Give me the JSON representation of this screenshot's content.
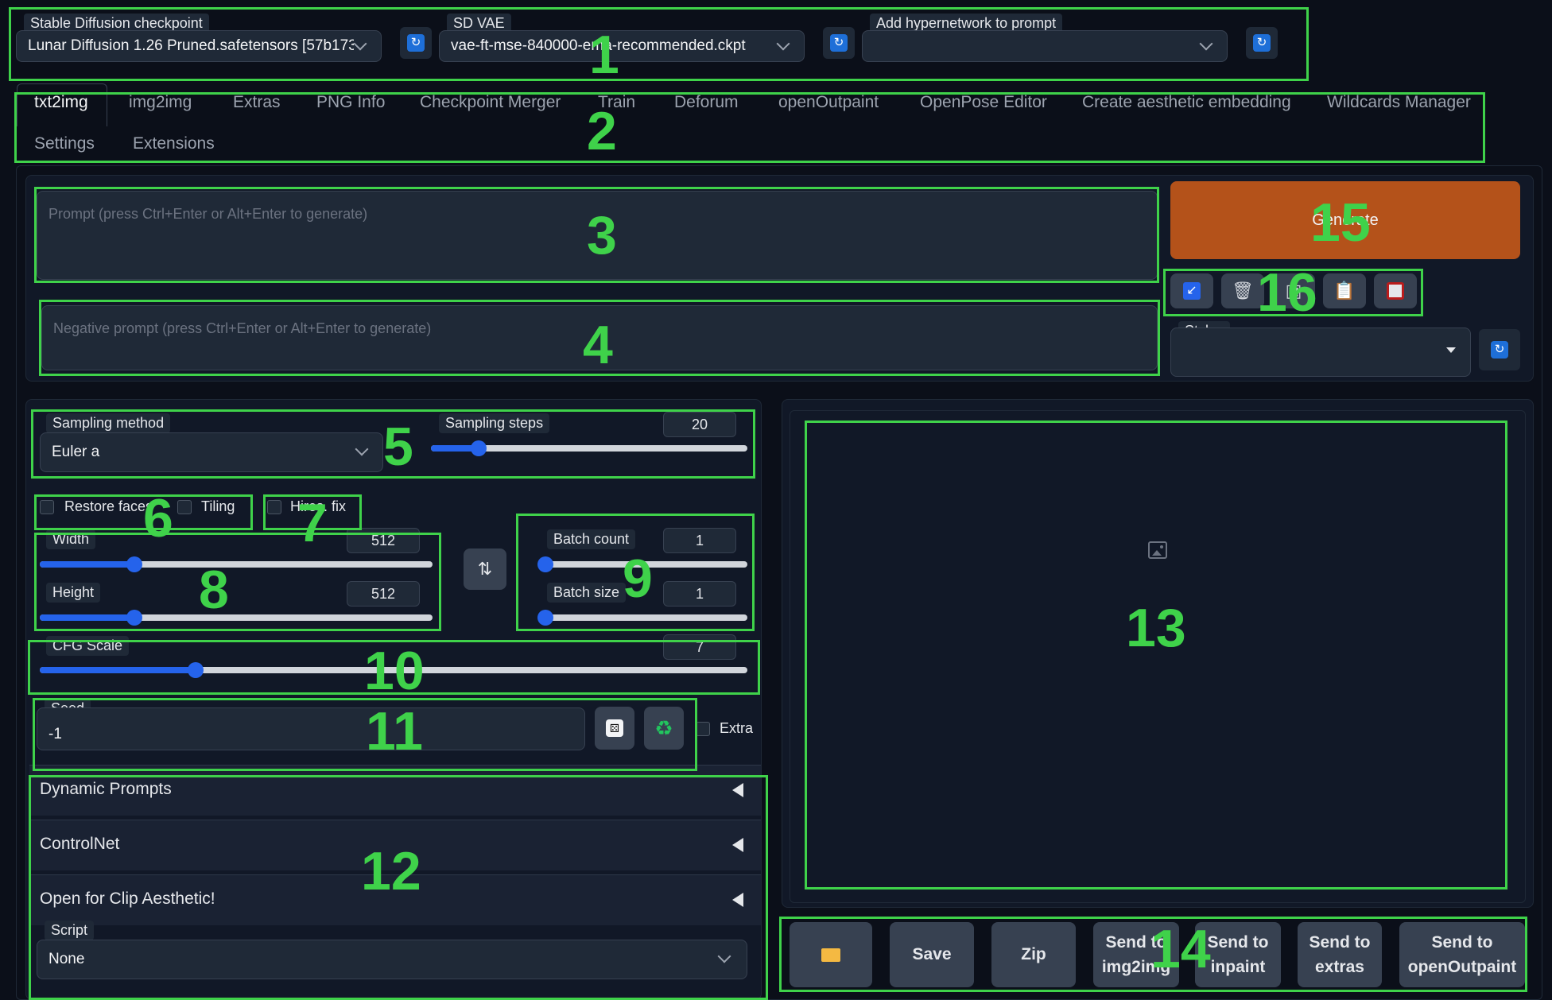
{
  "settings": {
    "checkpoint_label": "Stable Diffusion checkpoint",
    "checkpoint_value": "Lunar Diffusion 1.26 Pruned.safetensors [57b173",
    "vae_label": "SD VAE",
    "vae_value": "vae-ft-mse-840000-ema-recommended.ckpt",
    "hypernetwork_label": "Add hypernetwork to prompt",
    "hypernetwork_value": ""
  },
  "tabs": [
    "txt2img",
    "img2img",
    "Extras",
    "PNG Info",
    "Checkpoint Merger",
    "Train",
    "Deforum",
    "openOutpaint",
    "OpenPose Editor",
    "Create aesthetic embedding",
    "Wildcards Manager",
    "Settings",
    "Extensions"
  ],
  "prompt": {
    "placeholder": "Prompt (press Ctrl+Enter or Alt+Enter to generate)",
    "negative_placeholder": "Negative prompt (press Ctrl+Enter or Alt+Enter to generate)"
  },
  "generate": {
    "label": "Generate",
    "color": "#b4521a"
  },
  "styles": {
    "label": "Styles",
    "value": ""
  },
  "sampling": {
    "method_label": "Sampling method",
    "method_value": "Euler a",
    "steps_label": "Sampling steps",
    "steps_value": "20",
    "steps_fraction": 0.15
  },
  "options": {
    "restore_faces": "Restore faces",
    "tiling": "Tiling",
    "hires_fix": "Hires. fix"
  },
  "size": {
    "width_label": "Width",
    "width_value": "512",
    "height_label": "Height",
    "height_value": "512",
    "fraction": 0.24
  },
  "batch": {
    "count_label": "Batch count",
    "count_value": "1",
    "size_label": "Batch size",
    "size_value": "1"
  },
  "cfg": {
    "label": "CFG Scale",
    "value": "7",
    "fraction": 0.22
  },
  "seed": {
    "label": "Seed",
    "value": "-1",
    "extra_label": "Extra"
  },
  "accordions": [
    "Dynamic Prompts",
    "ControlNet",
    "Open for Clip Aesthetic!"
  ],
  "script": {
    "label": "Script",
    "value": "None"
  },
  "output_buttons": {
    "save": "Save",
    "zip": "Zip",
    "send_img2img": "Send to img2img",
    "send_inpaint": "Send to inpaint",
    "send_extras": "Send to extras",
    "send_openoutpaint": "Send to openOutpaint"
  },
  "annotations": [
    "1",
    "2",
    "3",
    "4",
    "5",
    "6",
    "7",
    "8",
    "9",
    "10",
    "11",
    "12",
    "13",
    "14",
    "15",
    "16"
  ],
  "accent_color": "#3fd24a"
}
